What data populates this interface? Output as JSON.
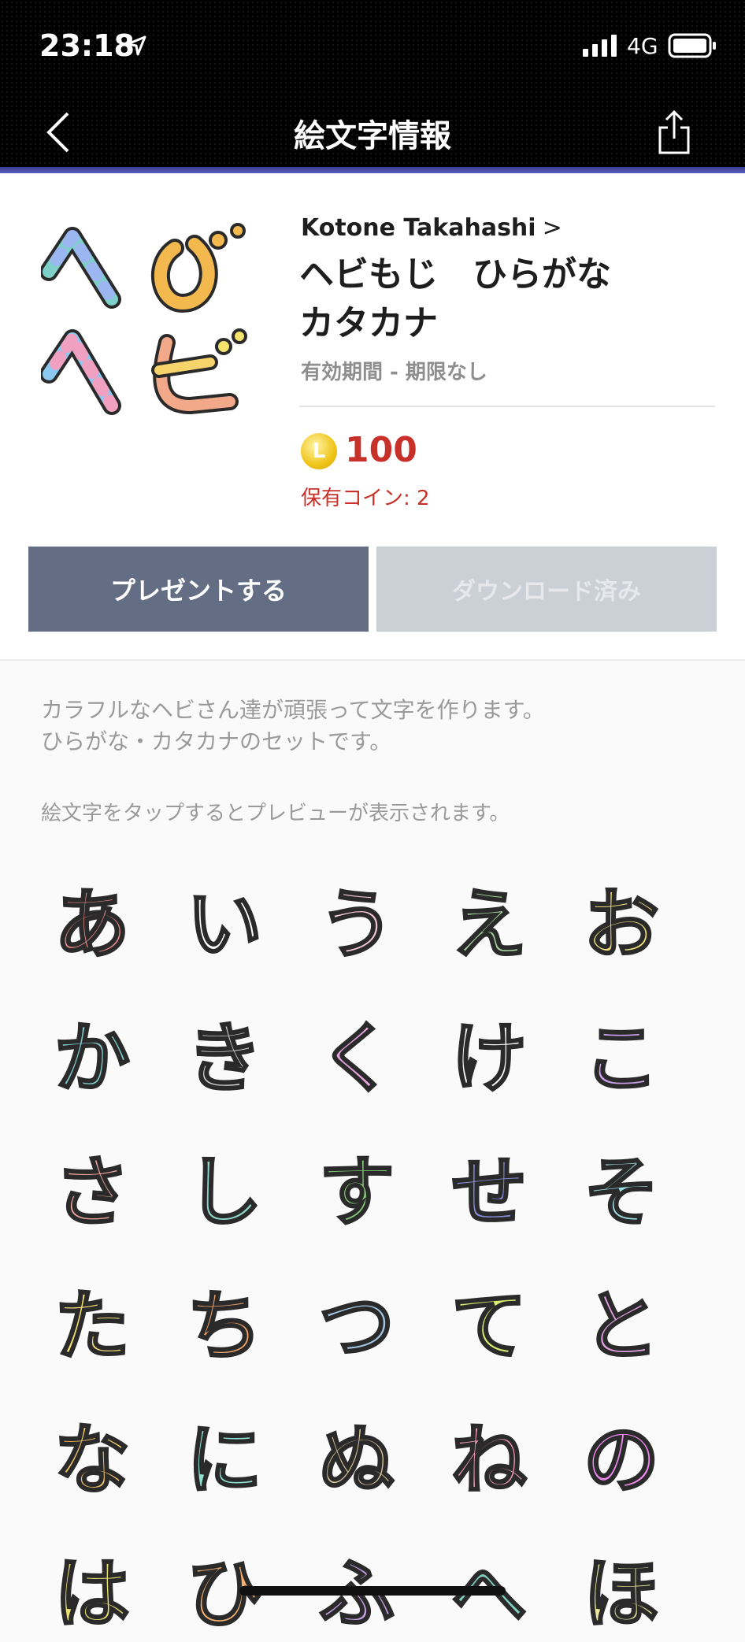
{
  "status": {
    "time": "23:18",
    "network": "4G"
  },
  "nav": {
    "title": "絵文字情報"
  },
  "pack": {
    "author": "Kotone Takahashi",
    "title_line1": "ヘビもじ　ひらがな",
    "title_line2": "カタカナ",
    "validity": "有効期間 - 期限なし",
    "coin_symbol": "L",
    "price": "100",
    "owned_coins": "保有コイン: 2"
  },
  "buttons": {
    "present": "プレゼントする",
    "download": "ダウンロード済み"
  },
  "description": "カラフルなヘビさん達が頑張って文字を作ります。\nひらがな・カタカナのセットです。",
  "hint": "絵文字をタップするとプレビューが表示されます。",
  "thumbnail_chars": [
    "へ",
    "び",
    "へ",
    "び"
  ],
  "emojis": [
    {
      "char": "あ",
      "color": "#e88a8a"
    },
    {
      "char": "い",
      "color": "#ffffff"
    },
    {
      "char": "う",
      "color": "#f4c7d6"
    },
    {
      "char": "え",
      "color": "#a8d8a0"
    },
    {
      "char": "お",
      "color": "#f1e07a"
    },
    {
      "char": "か",
      "color": "#7fc7c9"
    },
    {
      "char": "き",
      "color": "#d8d8d8"
    },
    {
      "char": "く",
      "color": "#e6a3e0"
    },
    {
      "char": "け",
      "color": "#ffffff"
    },
    {
      "char": "こ",
      "color": "#c79be6"
    },
    {
      "char": "さ",
      "color": "#f2a6a0"
    },
    {
      "char": "し",
      "color": "#8fd8c8"
    },
    {
      "char": "す",
      "color": "#86cc7a"
    },
    {
      "char": "せ",
      "color": "#8b8fe0"
    },
    {
      "char": "そ",
      "color": "#9ee0e6"
    },
    {
      "char": "た",
      "color": "#f4e070"
    },
    {
      "char": "ち",
      "color": "#f0a36a"
    },
    {
      "char": "つ",
      "color": "#a6c8e6"
    },
    {
      "char": "て",
      "color": "#d8ec70"
    },
    {
      "char": "と",
      "color": "#e6a0e6"
    },
    {
      "char": "な",
      "color": "#f5c56a"
    },
    {
      "char": "に",
      "color": "#8ee0d0"
    },
    {
      "char": "ぬ",
      "color": "#d8c49a"
    },
    {
      "char": "ね",
      "color": "#f09ab6"
    },
    {
      "char": "の",
      "color": "#ee88ee"
    },
    {
      "char": "は",
      "color": "#e8e070"
    },
    {
      "char": "ひ",
      "color": "#f5b070"
    },
    {
      "char": "ふ",
      "color": "#c8a0e6"
    },
    {
      "char": "へ",
      "color": "#80d0c0"
    },
    {
      "char": "ほ",
      "color": "#e8e8a0"
    }
  ]
}
